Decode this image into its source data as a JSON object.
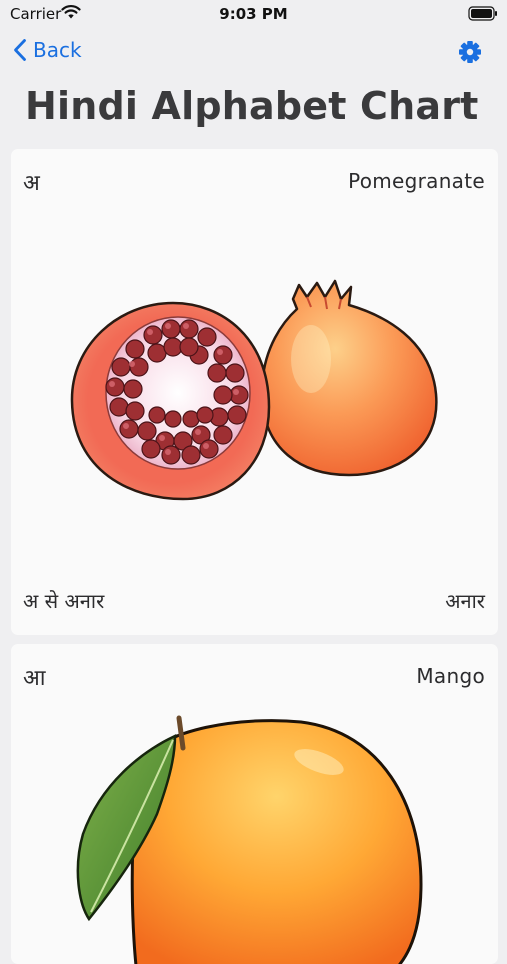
{
  "status": {
    "carrier": "Carrier",
    "time": "9:03 PM"
  },
  "nav": {
    "back_label": "Back"
  },
  "page": {
    "title": "Hindi Alphabet Chart"
  },
  "cards": [
    {
      "letter": "अ",
      "english": "Pomegranate",
      "phrase": "अ से अनार",
      "word": "अनार"
    },
    {
      "letter": "आ",
      "english": "Mango"
    }
  ],
  "colors": {
    "accent": "#1a6fe0",
    "background": "#efeff1",
    "card": "#fafafa"
  },
  "icons": [
    "wifi-icon",
    "battery-icon",
    "chevron-left-icon",
    "gear-icon",
    "pomegranate-image",
    "mango-image"
  ]
}
